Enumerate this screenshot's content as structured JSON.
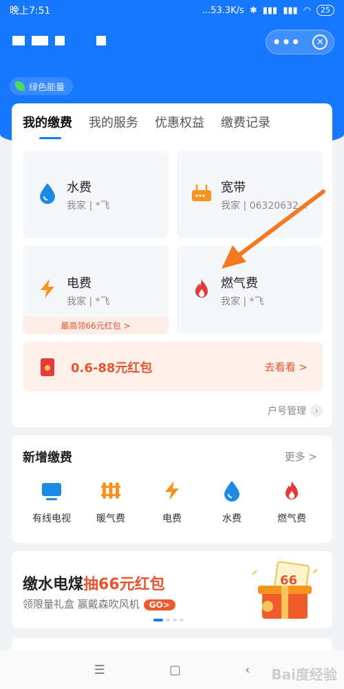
{
  "status_bar": {
    "time": "晚上7:51",
    "speed": "...53.3K/s",
    "battery": "25"
  },
  "header": {
    "banner_text": "绿色能量",
    "more_icon": "more-dots-icon",
    "close_icon": "close-circle-icon"
  },
  "tabs": [
    {
      "label": "我的缴费",
      "active": true
    },
    {
      "label": "我的服务",
      "active": false
    },
    {
      "label": "优惠权益",
      "active": false
    },
    {
      "label": "缴费记录",
      "active": false
    }
  ],
  "bills": [
    {
      "name": "水费",
      "account": "我家 | *飞",
      "icon": "water-drop-icon"
    },
    {
      "name": "宽带",
      "account": "我家 | 06320632...",
      "icon": "router-icon"
    },
    {
      "name": "电费",
      "account": "我家 | *飞",
      "icon": "lightning-icon",
      "promo": "最高领66元红包 >"
    },
    {
      "name": "燃气费",
      "account": "我家 | *飞",
      "icon": "flame-icon"
    }
  ],
  "redpack": {
    "amount": "0.6-88元红包",
    "action": "去看看 >"
  },
  "account_manage": "户号管理",
  "new_payment": {
    "title": "新增缴费",
    "more": "更多 >",
    "items": [
      {
        "label": "有线电视",
        "icon": "tv-icon"
      },
      {
        "label": "暖气费",
        "icon": "radiator-icon"
      },
      {
        "label": "电费",
        "icon": "lightning-icon"
      },
      {
        "label": "水费",
        "icon": "water-drop-icon"
      },
      {
        "label": "燃气费",
        "icon": "flame-icon"
      }
    ]
  },
  "promo": {
    "title_plain": "缴水电煤",
    "title_highlight": "抽66元红包",
    "subtitle": "领限量礼盒 赢戴森吹风机",
    "go": "GO>",
    "gift_text": "66"
  },
  "watermark": "Bai度经验",
  "colors": {
    "primary": "#1677ff",
    "accent": "#e8542e",
    "water": "#1e88e5",
    "lightning": "#f7931e",
    "flame": "#e53935"
  }
}
